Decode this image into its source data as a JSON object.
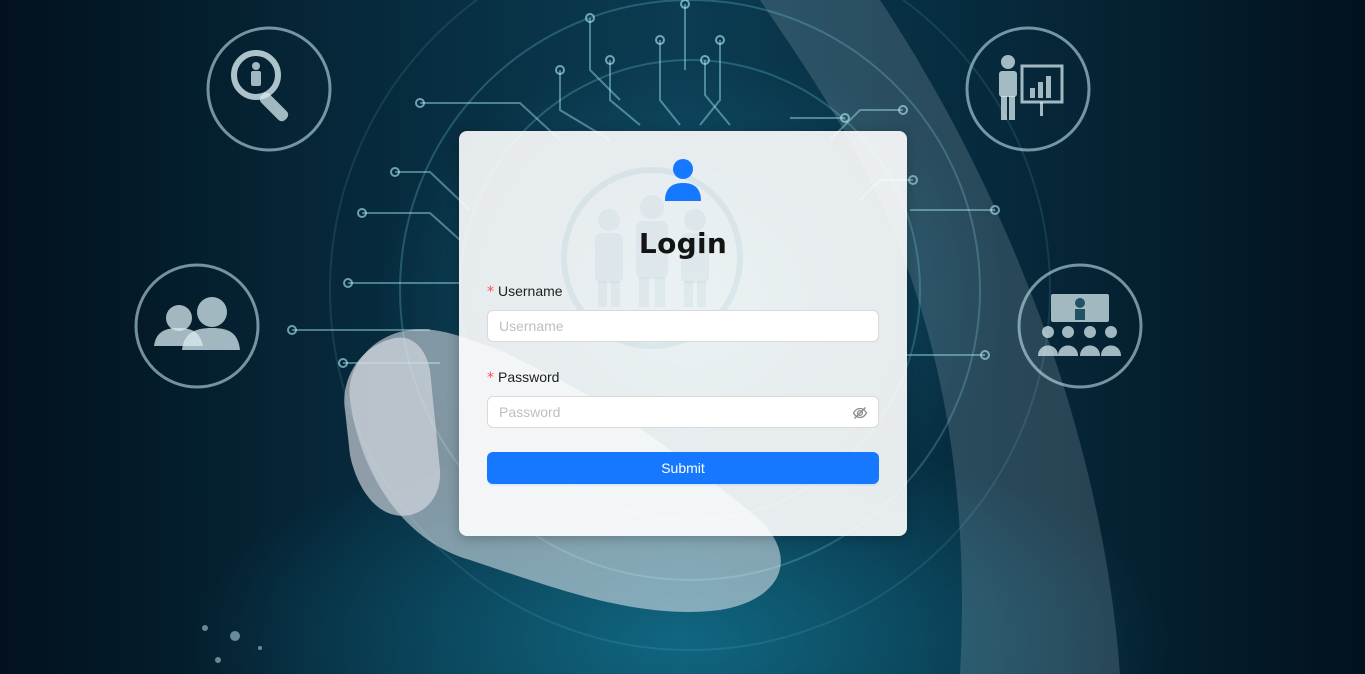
{
  "login_form": {
    "title": "Login",
    "username": {
      "label": "Username",
      "required_mark": "*",
      "placeholder": "Username",
      "value": ""
    },
    "password": {
      "label": "Password",
      "required_mark": "*",
      "placeholder": "Password",
      "value": ""
    },
    "submit_label": "Submit"
  },
  "icons": {
    "avatar": "user-icon",
    "password_toggle": "eye-invisible-icon"
  },
  "colors": {
    "primary": "#1677ff",
    "required": "#ff4d4f",
    "card_background": "#ffffff"
  }
}
